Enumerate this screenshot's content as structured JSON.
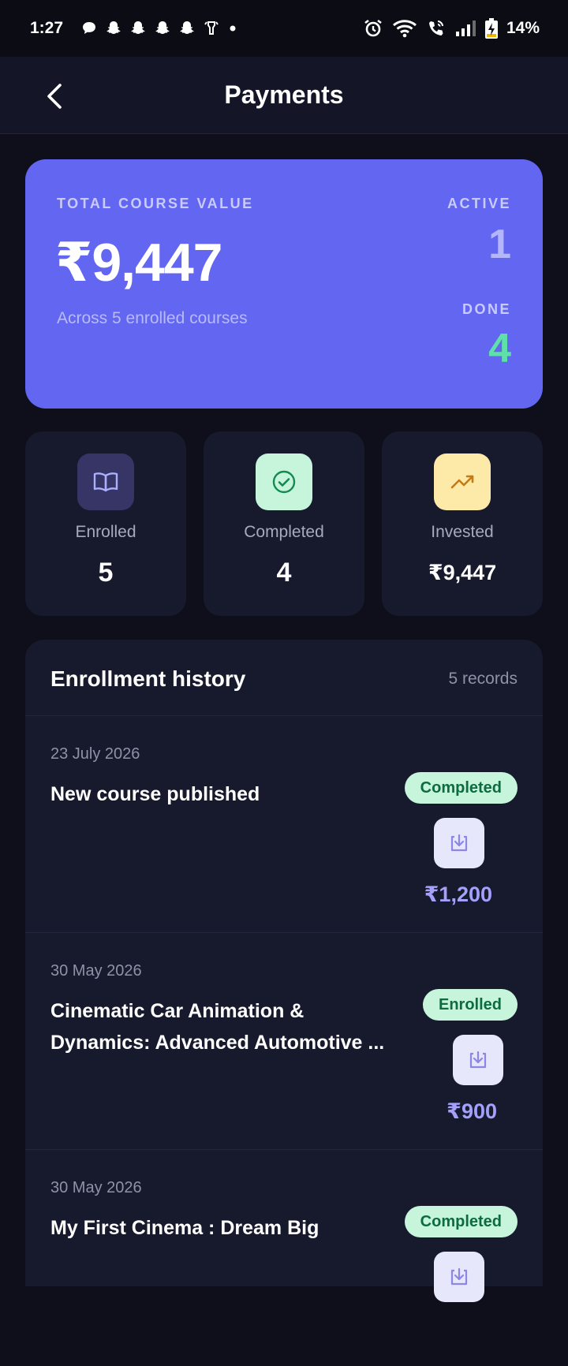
{
  "status_bar": {
    "time": "1:27",
    "battery": "14%"
  },
  "header": {
    "title": "Payments"
  },
  "hero": {
    "label": "TOTAL COURSE VALUE",
    "amount": "₹9,447",
    "subtitle": "Across 5 enrolled courses",
    "active_label": "ACTIVE",
    "active_value": "1",
    "done_label": "DONE",
    "done_value": "4"
  },
  "stats": [
    {
      "label": "Enrolled",
      "value": "5",
      "icon": "book-icon"
    },
    {
      "label": "Completed",
      "value": "4",
      "icon": "check-circle-icon"
    },
    {
      "label": "Invested",
      "value": "₹9,447",
      "icon": "trending-up-icon"
    }
  ],
  "history": {
    "title": "Enrollment history",
    "count": "5 records",
    "rows": [
      {
        "date": "23 July 2026",
        "title": "New course published",
        "status": "Completed",
        "amount": "₹1,200"
      },
      {
        "date": "30 May 2026",
        "title": "Cinematic Car Animation & Dynamics: Advanced Automotive ...",
        "status": "Enrolled",
        "amount": "₹900"
      },
      {
        "date": "30 May 2026",
        "title": "My First Cinema : Dream Big",
        "status": "Completed",
        "amount": ""
      }
    ]
  },
  "colors": {
    "accent": "#6366f1",
    "background": "#0e0f1a",
    "card": "#171a2c",
    "done_green": "#5ee0a8",
    "badge_bg": "#c7f5dc",
    "amount_purple": "#a5a0fb"
  }
}
